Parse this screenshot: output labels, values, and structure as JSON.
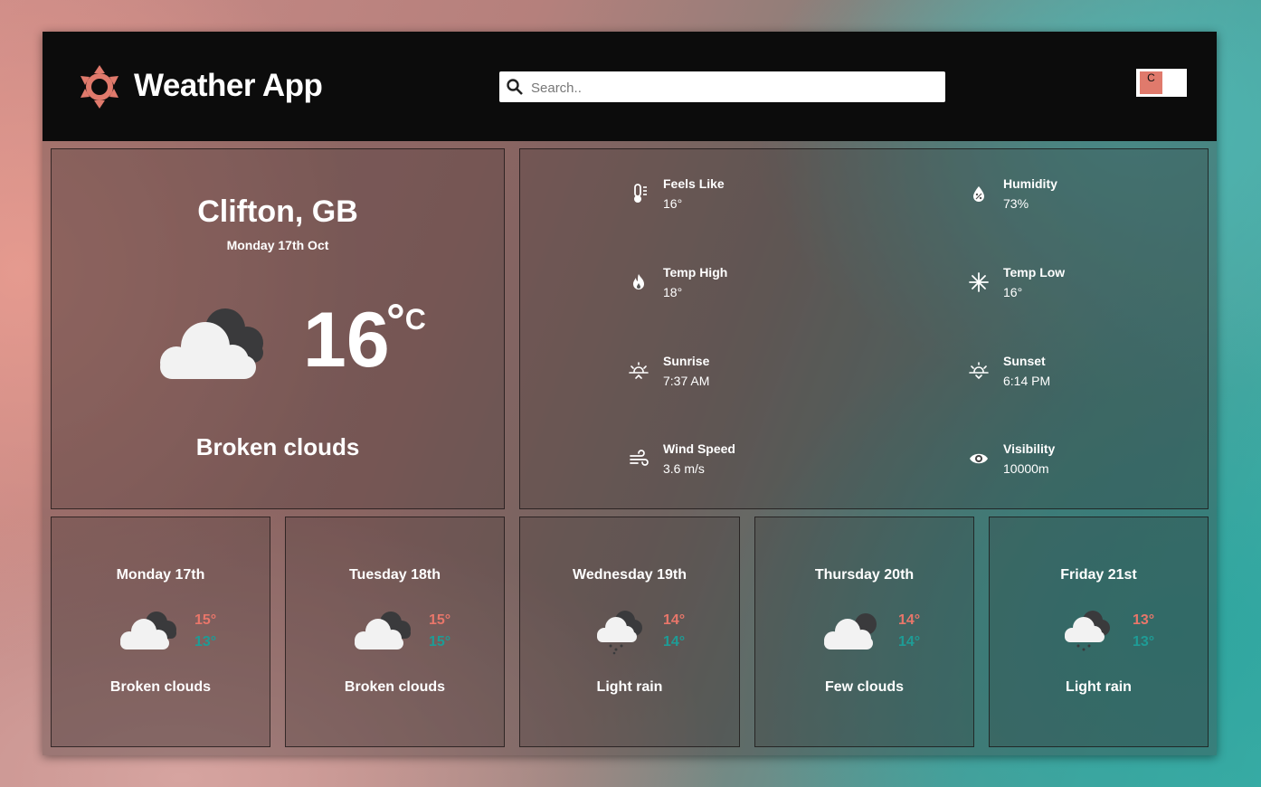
{
  "header": {
    "app_title": "Weather App",
    "search_placeholder": "Search..",
    "unit_toggle_label": "C",
    "accent_color": "#e07a6c"
  },
  "current": {
    "location": "Clifton, GB",
    "date": "Monday 17th Oct",
    "temperature": "16",
    "unit_symbol": "°",
    "unit_letter": "C",
    "condition": "Broken clouds",
    "icon": "broken-clouds-icon"
  },
  "details": [
    {
      "label": "Feels Like",
      "value": "16°",
      "icon": "thermometer-icon"
    },
    {
      "label": "Humidity",
      "value": "73%",
      "icon": "humidity-drop-icon"
    },
    {
      "label": "Temp High",
      "value": "18°",
      "icon": "flame-icon"
    },
    {
      "label": "Temp Low",
      "value": "16°",
      "icon": "snowflake-icon"
    },
    {
      "label": "Sunrise",
      "value": "7:37 AM",
      "icon": "sunrise-icon"
    },
    {
      "label": "Sunset",
      "value": "6:14 PM",
      "icon": "sunset-icon"
    },
    {
      "label": "Wind Speed",
      "value": "3.6 m/s",
      "icon": "wind-icon"
    },
    {
      "label": "Visibility",
      "value": "10000m",
      "icon": "eye-icon"
    }
  ],
  "forecast": [
    {
      "day": "Monday 17th",
      "high": "15°",
      "low": "13°",
      "condition": "Broken clouds",
      "icon": "broken-clouds-icon"
    },
    {
      "day": "Tuesday 18th",
      "high": "15°",
      "low": "15°",
      "condition": "Broken clouds",
      "icon": "broken-clouds-icon"
    },
    {
      "day": "Wednesday 19th",
      "high": "14°",
      "low": "14°",
      "condition": "Light rain",
      "icon": "light-rain-icon"
    },
    {
      "day": "Thursday 20th",
      "high": "14°",
      "low": "14°",
      "condition": "Few clouds",
      "icon": "few-clouds-icon"
    },
    {
      "day": "Friday 21st",
      "high": "13°",
      "low": "13°",
      "condition": "Light rain",
      "icon": "light-rain-icon"
    }
  ],
  "colors": {
    "high_temp": "#e8766a",
    "low_temp": "#1e9c96",
    "header_bg": "#0c0c0c"
  }
}
